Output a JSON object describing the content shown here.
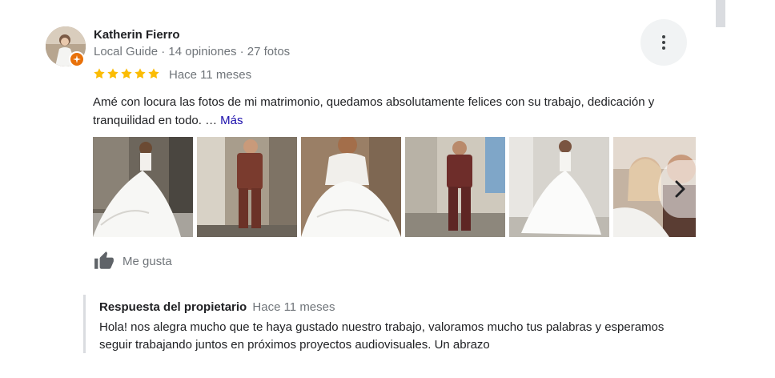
{
  "review": {
    "author": {
      "name": "Katherin Fierro",
      "meta": "Local Guide · 14 opiniones · 27 fotos"
    },
    "rating": 5,
    "stars": [
      "★",
      "★",
      "★",
      "★",
      "★"
    ],
    "date": "Hace 11 meses",
    "text": "Amé con locura las fotos de mi matrimonio, quedamos absolutamente felices con su trabajo, dedicación y tranquilidad en todo. …",
    "more_label": "Más",
    "photos": [
      {
        "name": "photo-1",
        "subject": "bride"
      },
      {
        "name": "photo-2",
        "subject": "groom"
      },
      {
        "name": "photo-3",
        "subject": "bride"
      },
      {
        "name": "photo-4",
        "subject": "groom"
      },
      {
        "name": "photo-5",
        "subject": "bride"
      },
      {
        "name": "photo-6",
        "subject": "couple"
      }
    ],
    "like_label": "Me gusta",
    "owner_reply": {
      "title": "Respuesta del propietario",
      "date": "Hace 11 meses",
      "text": "Hola! nos alegra mucho que te haya gustado nuestro trabajo, valoramos mucho tus palabras y esperamos seguir trabajando juntos en próximos proyectos audiovisuales. Un abrazo"
    }
  },
  "colors": {
    "star": "#fbbc04",
    "link": "#1a0dab",
    "secondary_text": "#70757a",
    "local_guide_badge": "#e8710a"
  },
  "icons": [
    "more-vert-icon",
    "star-icon",
    "thumb-up-icon",
    "chevron-right-icon",
    "local-guide-icon"
  ]
}
